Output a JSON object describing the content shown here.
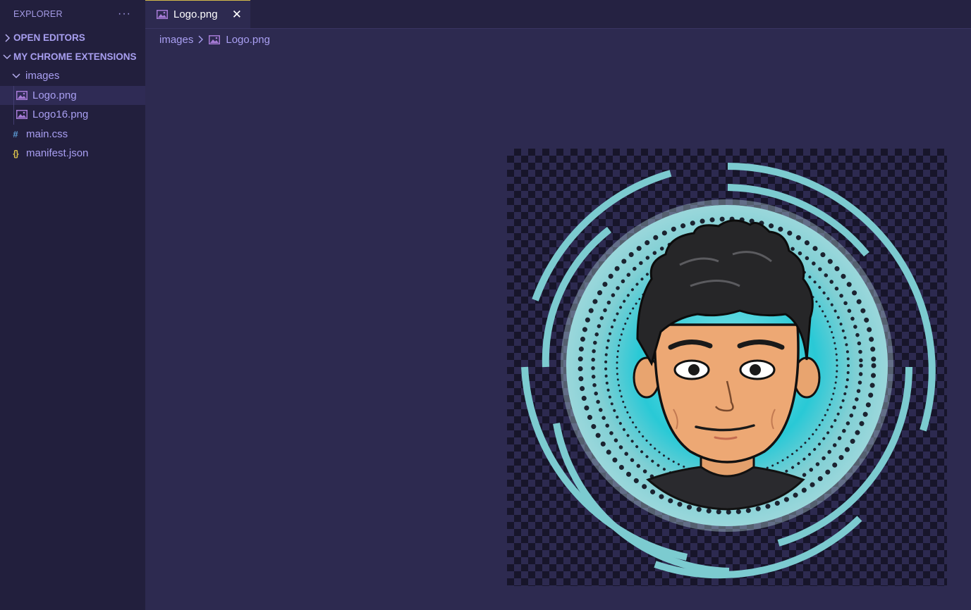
{
  "sidebar": {
    "title": "EXPLORER",
    "more_label": "···",
    "sections": {
      "open_editors": "OPEN EDITORS",
      "project": "MY CHROME EXTENSIONS"
    },
    "tree": {
      "folder": "images",
      "files_in_folder": [
        "Logo.png",
        "Logo16.png"
      ],
      "root_files": [
        "main.css",
        "manifest.json"
      ]
    }
  },
  "tabs": [
    {
      "label": "Logo.png",
      "active": true,
      "close_glyph": "✕"
    }
  ],
  "breadcrumb": {
    "folder": "images",
    "file": "Logo.png"
  },
  "preview": {
    "image_name": "Logo.png",
    "description_icon": "avatar-image"
  },
  "colors": {
    "sidebar_bg": "#221f3d",
    "editor_bg": "#2d2a50",
    "accent_tab_border": "#d4b94a",
    "text_purple": "#a99ff2",
    "teal": "#7ccbd0"
  }
}
